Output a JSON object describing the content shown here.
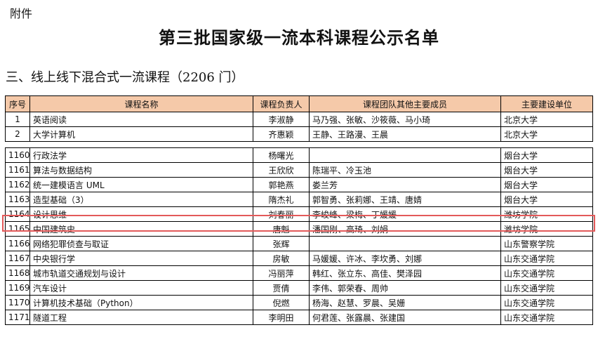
{
  "header": {
    "attachment": "附件",
    "title": "第三批国家级一流本科课程公示名单",
    "section": "三、线上线下混合式一流课程（2206 门）"
  },
  "table": {
    "columns": [
      "序号",
      "课程名称",
      "课程负责人",
      "课程团队其他主要成员",
      "主要建设单位"
    ],
    "rows_top": [
      {
        "no": "1",
        "name": "英语阅读",
        "leader": "李淑静",
        "members": "马乃强、张敏、沙筱薇、马小琦",
        "unit": "北京大学"
      },
      {
        "no": "2",
        "name": "大学计算机",
        "leader": "齐惠颖",
        "members": "王静、王路漫、王晨",
        "unit": "北京大学"
      }
    ],
    "rows_bottom": [
      {
        "no": "1160",
        "name": "行政法学",
        "leader": "杨曙光",
        "members": "",
        "unit": "烟台大学"
      },
      {
        "no": "1161",
        "name": "算法与数据结构",
        "leader": "王欣欣",
        "members": "陈瑞平、冷玉池",
        "unit": "烟台大学"
      },
      {
        "no": "1162",
        "name": "统一建模语言 UML",
        "leader": "郭艳燕",
        "members": "娄兰芳",
        "unit": "烟台大学"
      },
      {
        "no": "1163",
        "name": "造型基础（3）",
        "leader": "隋杰礼",
        "members": "郭智勇、张莉娜、王靖、唐婧",
        "unit": "烟台大学"
      },
      {
        "no": "1164",
        "name": "设计思维",
        "leader": "刘春丽",
        "members": "李峻峰、梁梅、丁媛媛",
        "unit": "潍坊学院"
      },
      {
        "no": "1165",
        "name": "中国建筑史",
        "leader": "唐魁",
        "members": "潘国刚、高琦、刘娟",
        "unit": "潍坊学院"
      },
      {
        "no": "1166",
        "name": "网络犯罪侦查与取证",
        "leader": "张辉",
        "members": "",
        "unit": "山东警察学院"
      },
      {
        "no": "1167",
        "name": "中央银行学",
        "leader": "房敏",
        "members": "马媛媛、许冰、李坎勇、刘娜",
        "unit": "山东交通学院"
      },
      {
        "no": "1168",
        "name": "城市轨道交通规划与设计",
        "leader": "冯丽萍",
        "members": "韩红、张立东、高佳、樊泽园",
        "unit": "山东交通学院"
      },
      {
        "no": "1169",
        "name": "汽车设计",
        "leader": "贾倩",
        "members": "李伟、郭荣春、周帅",
        "unit": "山东交通学院"
      },
      {
        "no": "1170",
        "name": "计算机技术基础（Python）",
        "leader": "倪燃",
        "members": "杨海、赵慧、罗晨、吴姗",
        "unit": "山东交通学院"
      },
      {
        "no": "1171",
        "name": "隧道工程",
        "leader": "李明田",
        "members": "何君莲、张露晨、张建国",
        "unit": "山东交通学院"
      }
    ]
  },
  "colors": {
    "header_bg": "#f5c9a9",
    "highlight_border": "#e35a5a"
  }
}
